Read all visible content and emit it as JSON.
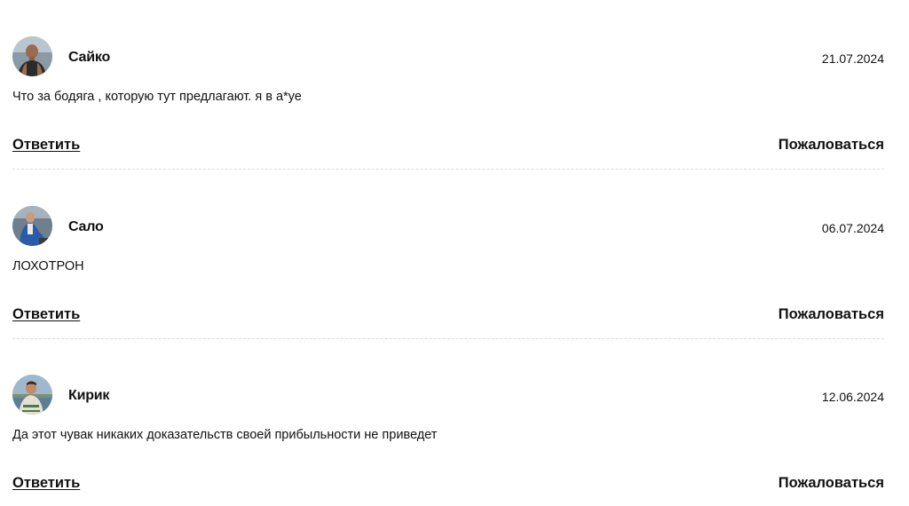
{
  "comments": [
    {
      "author": "Сайко",
      "date": "21.07.2024",
      "text": "Что за бодяга , которую тут предлагают. я в а*уе",
      "reply_label": "Ответить",
      "report_label": "Пожаловаться",
      "avatar_icon": "user-photo-icon"
    },
    {
      "author": "Сало",
      "date": "06.07.2024",
      "text": "ЛОХОТРОН",
      "reply_label": "Ответить",
      "report_label": "Пожаловаться",
      "avatar_icon": "user-photo-icon"
    },
    {
      "author": "Кирик",
      "date": "12.06.2024",
      "text": "Да этот чувак никаких доказательств своей прибыльности не приведет",
      "reply_label": "Ответить",
      "report_label": "Пожаловаться",
      "avatar_icon": "user-photo-icon"
    }
  ],
  "colors": {
    "text": "#111111",
    "divider": "#dcdcdc",
    "background": "#ffffff"
  }
}
